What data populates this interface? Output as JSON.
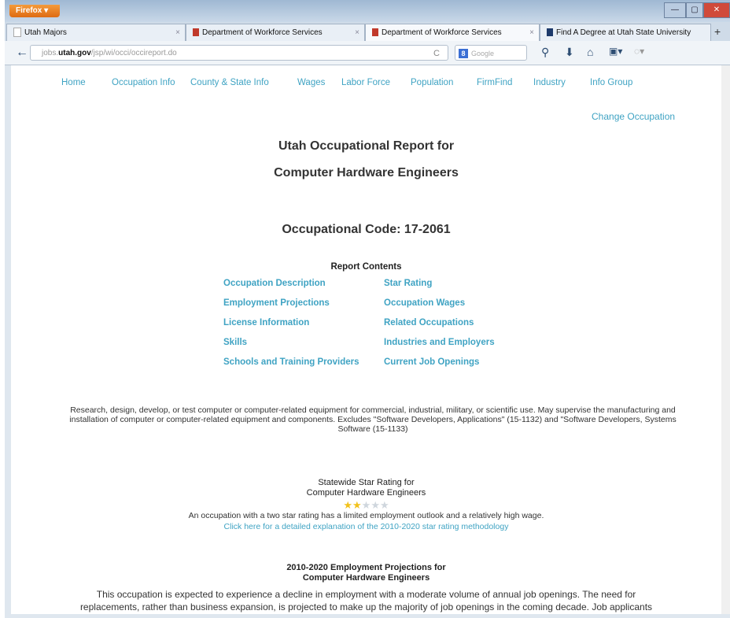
{
  "browser": {
    "menu_label": "Firefox",
    "tabs": [
      {
        "label": "Utah Majors"
      },
      {
        "label": "Department of Workforce Services"
      },
      {
        "label": "Department of Workforce Services"
      },
      {
        "label": "Find A Degree at Utah State University"
      }
    ],
    "url_prefix": "jobs.",
    "url_domain": "utah.gov",
    "url_path": "/jsp/wi/occi/occireport.do",
    "search_placeholder": "Google"
  },
  "site_nav": [
    "Home",
    "Occupation Info",
    "County & State Info",
    "Wages",
    "Labor Force",
    "Population",
    "FirmFind",
    "Industry",
    "Info Group"
  ],
  "change_occupation": "Change Occupation",
  "report": {
    "title_line1": "Utah Occupational Report for",
    "title_line2": "Computer Hardware Engineers",
    "code_line": "Occupational Code:  17-2061"
  },
  "contents": {
    "title": "Report Contents",
    "left": [
      "Occupation Description",
      "Employment Projections",
      "License Information",
      "Skills",
      "Schools and Training Providers"
    ],
    "right": [
      "Star Rating",
      "Occupation Wages",
      "Related Occupations",
      "Industries and Employers",
      "Current Job Openings"
    ]
  },
  "description": "Research, design, develop, or test computer or computer-related equipment for commercial, industrial, military, or scientific use. May supervise the manufacturing and installation of computer or computer-related equipment and components. Excludes \"Software Developers, Applications\" (15-1132) and \"Software Developers, Systems Software (15-1133)",
  "star_rating": {
    "title1": "Statewide Star Rating for",
    "title2": "Computer Hardware Engineers",
    "stars_filled": 2,
    "stars_total": 5,
    "explanation": "An occupation with a two star rating has a limited employment outlook and a relatively high wage.",
    "link": "Click here for a detailed explanation of the 2010-2020 star rating methodology"
  },
  "projections": {
    "title1": "2010-2020 Employment Projections  for",
    "title2": "Computer Hardware Engineers",
    "text_line1": "This occupation is expected to experience a decline in employment with a moderate volume of annual job openings. The need for",
    "text_line2": "replacements, rather than business expansion, is projected to make up the majority of job openings in the coming decade. Job applicants"
  },
  "colors": {
    "link": "#3fa3c3",
    "star_filled": "#f2c21b",
    "star_empty": "#cfd6dd"
  }
}
